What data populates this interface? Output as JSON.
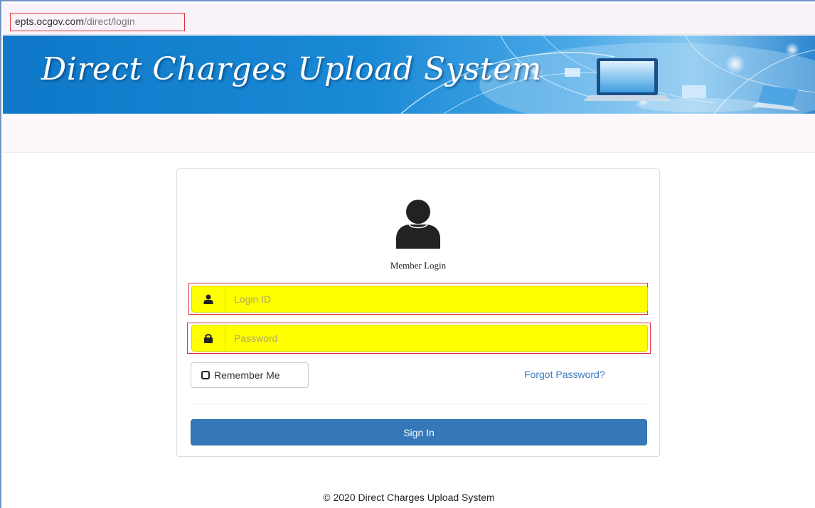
{
  "browser": {
    "url_host": "epts.ocgov.com",
    "url_path": "/direct/login"
  },
  "header": {
    "title": "Direct Charges Upload System"
  },
  "login": {
    "heading": "Member Login",
    "login_id_placeholder": "Login ID",
    "password_placeholder": "Password",
    "remember_label": "Remember Me",
    "forgot_label": "Forgot Password?",
    "signin_label": "Sign In"
  },
  "footer": {
    "text": "© 2020 Direct Charges Upload System"
  },
  "colors": {
    "banner": "#1a8ad6",
    "input_highlight": "#ffff00",
    "primary_button": "#3478b8",
    "link": "#3a7bbf",
    "annotation_outline": "#e0343a"
  },
  "icons": {
    "avatar": "user-silhouette-icon",
    "login_id": "user-icon",
    "password": "lock-icon",
    "remember": "checkbox-icon"
  }
}
